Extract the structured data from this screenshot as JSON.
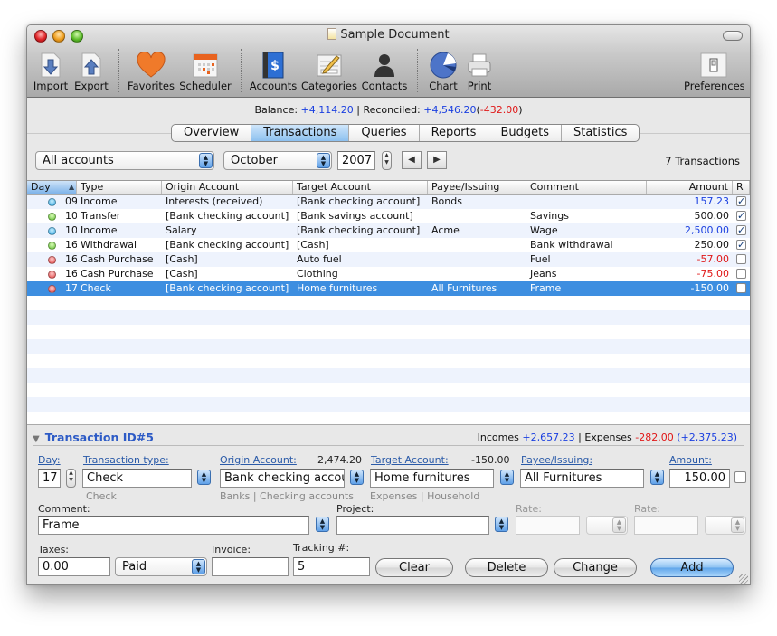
{
  "window": {
    "title": "Sample Document"
  },
  "toolbar": {
    "items": [
      {
        "label": "Import",
        "icon": "import-icon"
      },
      {
        "label": "Export",
        "icon": "export-icon"
      },
      {
        "label": "Favorites",
        "icon": "heart-icon"
      },
      {
        "label": "Scheduler",
        "icon": "calendar-icon"
      },
      {
        "label": "Accounts",
        "icon": "ledger-dollar-icon"
      },
      {
        "label": "Categories",
        "icon": "notepad-pencil-icon"
      },
      {
        "label": "Contacts",
        "icon": "person-silhouette-icon"
      },
      {
        "label": "Chart",
        "icon": "pie-chart-icon"
      },
      {
        "label": "Print",
        "icon": "printer-icon"
      },
      {
        "label": "Preferences",
        "icon": "light-switch-icon"
      }
    ]
  },
  "balance": {
    "balance_label": "Balance:",
    "balance_value": "+4,114.20",
    "separator": "|",
    "reconciled_label": "Reconciled:",
    "reconciled_value": "+4,546.20",
    "difference": "-432.00"
  },
  "tabs": [
    {
      "label": "Overview",
      "active": false
    },
    {
      "label": "Transactions",
      "active": true
    },
    {
      "label": "Queries",
      "active": false
    },
    {
      "label": "Reports",
      "active": false
    },
    {
      "label": "Budgets",
      "active": false
    },
    {
      "label": "Statistics",
      "active": false
    }
  ],
  "filters": {
    "account": "All accounts",
    "month": "October",
    "year": "2007",
    "transaction_count": "7 Transactions"
  },
  "table": {
    "columns": [
      "Day",
      "Type",
      "Origin Account",
      "Target Account",
      "Payee/Issuing",
      "Comment",
      "Amount",
      "R"
    ],
    "sort_column": "Day",
    "sort_direction": "ascending",
    "rows": [
      {
        "status": "blue",
        "day": "09",
        "type": "Income",
        "origin": "Interests (received)",
        "target": "[Bank checking account]",
        "payee": "Bonds",
        "comment": "",
        "amount": "157.23",
        "amount_color": "blue",
        "reconciled": true,
        "selected": false
      },
      {
        "status": "green",
        "day": "10",
        "type": "Transfer",
        "origin": "[Bank checking account]",
        "target": "[Bank savings account]",
        "payee": "",
        "comment": "Savings",
        "amount": "500.00",
        "amount_color": "black",
        "reconciled": true,
        "selected": false
      },
      {
        "status": "blue",
        "day": "10",
        "type": "Income",
        "origin": "Salary",
        "target": "[Bank checking account]",
        "payee": "Acme",
        "comment": "Wage",
        "amount": "2,500.00",
        "amount_color": "blue",
        "reconciled": true,
        "selected": false
      },
      {
        "status": "green",
        "day": "16",
        "type": "Withdrawal",
        "origin": "[Bank checking account]",
        "target": "[Cash]",
        "payee": "",
        "comment": "Bank withdrawal",
        "amount": "250.00",
        "amount_color": "black",
        "reconciled": true,
        "selected": false
      },
      {
        "status": "red",
        "day": "16",
        "type": "Cash Purchase",
        "origin": "[Cash]",
        "target": "Auto fuel",
        "payee": "",
        "comment": "Fuel",
        "amount": "-57.00",
        "amount_color": "red",
        "reconciled": false,
        "selected": false
      },
      {
        "status": "red",
        "day": "16",
        "type": "Cash Purchase",
        "origin": "[Cash]",
        "target": "Clothing",
        "payee": "",
        "comment": "Jeans",
        "amount": "-75.00",
        "amount_color": "red",
        "reconciled": false,
        "selected": false
      },
      {
        "status": "red",
        "day": "17",
        "type": "Check",
        "origin": "[Bank checking account]",
        "target": "Home furnitures",
        "payee": "All Furnitures",
        "comment": "Frame",
        "amount": "-150.00",
        "amount_color": "white",
        "reconciled": false,
        "selected": true
      }
    ]
  },
  "details": {
    "title": "Transaction ID#5",
    "summary": {
      "incomes_label": "Incomes",
      "incomes": "+2,657.23",
      "expenses_label": "Expenses",
      "expenses": "-282.00",
      "net": "+2,375.23"
    },
    "day_label": "Day:",
    "day": "17",
    "type_label": "Transaction type:",
    "type": "Check",
    "type_sub": "Check",
    "origin_label": "Origin Account:",
    "origin_balance": "2,474.20",
    "origin": "Bank checking accou",
    "origin_sub": "Banks | Checking accounts",
    "target_label": "Target Account:",
    "target_balance": "-150.00",
    "target": "Home furnitures",
    "target_sub": "Expenses | Household",
    "payee_label": "Payee/Issuing:",
    "payee": "All Furnitures",
    "amount_label": "Amount:",
    "amount": "150.00",
    "amount_checked": false,
    "comment_label": "Comment:",
    "comment": "Frame",
    "project_label": "Project:",
    "project": "",
    "rate1_label": "Rate:",
    "rate1": "",
    "rate2_label": "Rate:",
    "rate2": "",
    "taxes_label": "Taxes:",
    "taxes": "0.00",
    "tax_status": "Paid",
    "invoice_label": "Invoice:",
    "invoice": "",
    "tracking_label": "Tracking #:",
    "tracking": "5"
  },
  "buttons": {
    "clear": "Clear",
    "delete": "Delete",
    "change": "Change",
    "add": "Add"
  }
}
